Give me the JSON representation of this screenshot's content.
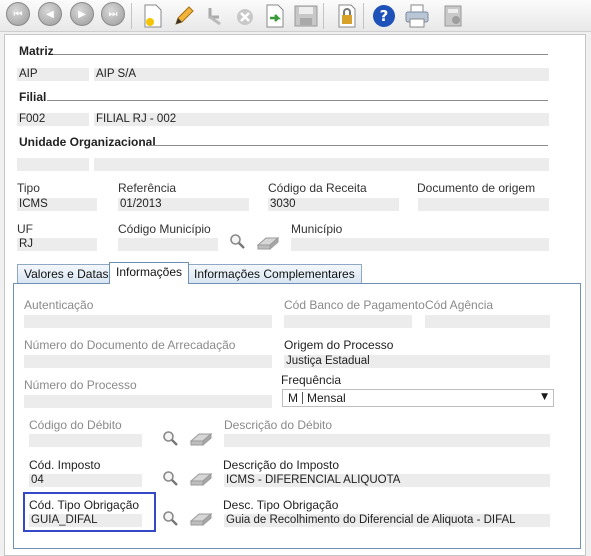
{
  "toolbar": {
    "icons": [
      "first-record-icon",
      "previous-record-icon",
      "next-record-icon",
      "last-record-icon",
      "new-document-icon",
      "edit-pencil-icon",
      "undo-icon",
      "cancel-icon",
      "confirm-icon",
      "save-icon",
      "lock-icon",
      "help-icon",
      "print-icon",
      "calculator-icon"
    ]
  },
  "matriz": {
    "header": "Matriz",
    "code": "AIP",
    "name": "AIP S/A"
  },
  "filial": {
    "header": "Filial",
    "code": "F002",
    "name": "FILIAL RJ - 002"
  },
  "unidade": {
    "header": "Unidade Organizacional",
    "code": "",
    "name": ""
  },
  "form": {
    "tipo_label": "Tipo",
    "tipo_value": "ICMS",
    "referencia_label": "Referência",
    "referencia_value": "01/2013",
    "codigo_receita_label": "Código da Receita",
    "codigo_receita_value": "3030",
    "doc_origem_label": "Documento de origem",
    "doc_origem_value": "",
    "uf_label": "UF",
    "uf_value": "RJ",
    "cod_municipio_label": "Código Município",
    "cod_municipio_value": "",
    "municipio_label": "Município",
    "municipio_value": ""
  },
  "tabs": [
    {
      "label": "Valores e Datas"
    },
    {
      "label": "Informações"
    },
    {
      "label": "Informações Complementares"
    }
  ],
  "info": {
    "autenticacao_label": "Autenticação",
    "autenticacao_value": "",
    "cod_banco_label": "Cód Banco de Pagamento",
    "cod_banco_value": "",
    "cod_agencia_label": "Cód Agência",
    "cod_agencia_value": "",
    "num_doc_arrecadacao_label": "Número do Documento de Arrecadação",
    "num_doc_arrecadacao_value": "",
    "origem_processo_label": "Origem do Processo",
    "origem_processo_value": "Justiça Estadual",
    "num_processo_label": "Número do Processo",
    "num_processo_value": "",
    "frequencia_label": "Frequência",
    "frequencia_code": "M",
    "frequencia_value": "Mensal",
    "cod_debito_label": "Código do Débito",
    "cod_debito_value": "",
    "desc_debito_label": "Descrição do Débito",
    "desc_debito_value": "",
    "cod_imposto_label": "Cód. Imposto",
    "cod_imposto_value": "04",
    "desc_imposto_label": "Descrição do Imposto",
    "desc_imposto_value": "ICMS - DIFERENCIAL ALIQUOTA",
    "cod_tipo_obrigacao_label": "Cód. Tipo Obrigação",
    "cod_tipo_obrigacao_value": "GUIA_DIFAL",
    "desc_tipo_obrigacao_label": "Desc. Tipo Obrigação",
    "desc_tipo_obrigacao_value": "Guia de Recolhimento do Diferencial de Aliquota - DIFAL"
  },
  "colors": {
    "tab_border": "#6f8fb5",
    "highlight": "#3548c8",
    "field_bg": "#ececec"
  }
}
